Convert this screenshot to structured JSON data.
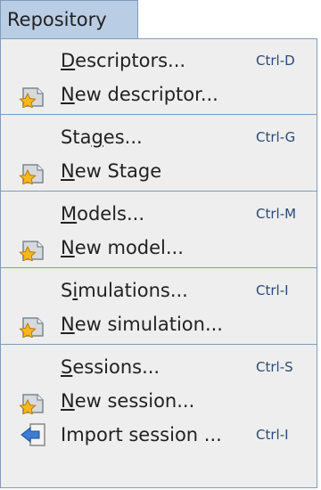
{
  "menubar": {
    "title": "Repository"
  },
  "menu": {
    "groups": [
      [
        {
          "pre": "",
          "u": "D",
          "post": "escriptors...",
          "accel": "Ctrl-D",
          "icon": ""
        },
        {
          "pre": "",
          "u": "N",
          "post": "ew descriptor...",
          "accel": "",
          "icon": "new-item-star-icon"
        }
      ],
      [
        {
          "pre": "Sta",
          "u": "g",
          "post": "es...",
          "accel": "Ctrl-G",
          "icon": ""
        },
        {
          "pre": "",
          "u": "N",
          "post": "ew Stage",
          "accel": "",
          "icon": "new-item-star-icon"
        }
      ],
      [
        {
          "pre": "",
          "u": "M",
          "post": "odels...",
          "accel": "Ctrl-M",
          "icon": ""
        },
        {
          "pre": "",
          "u": "N",
          "post": "ew model...",
          "accel": "",
          "icon": "new-item-star-icon"
        }
      ],
      [
        {
          "pre": "S",
          "u": "i",
          "post": "mulations...",
          "accel": "Ctrl-I",
          "icon": ""
        },
        {
          "pre": "",
          "u": "N",
          "post": "ew simulation...",
          "accel": "",
          "icon": "new-item-star-icon"
        }
      ],
      [
        {
          "pre": "",
          "u": "S",
          "post": "essions...",
          "accel": "Ctrl-S",
          "icon": ""
        },
        {
          "pre": "",
          "u": "N",
          "post": "ew session...",
          "accel": "",
          "icon": "new-item-star-icon"
        },
        {
          "pre": "Import session ...",
          "u": "",
          "post": "",
          "accel": "Ctrl-I",
          "icon": "import-arrow-icon"
        }
      ]
    ]
  }
}
